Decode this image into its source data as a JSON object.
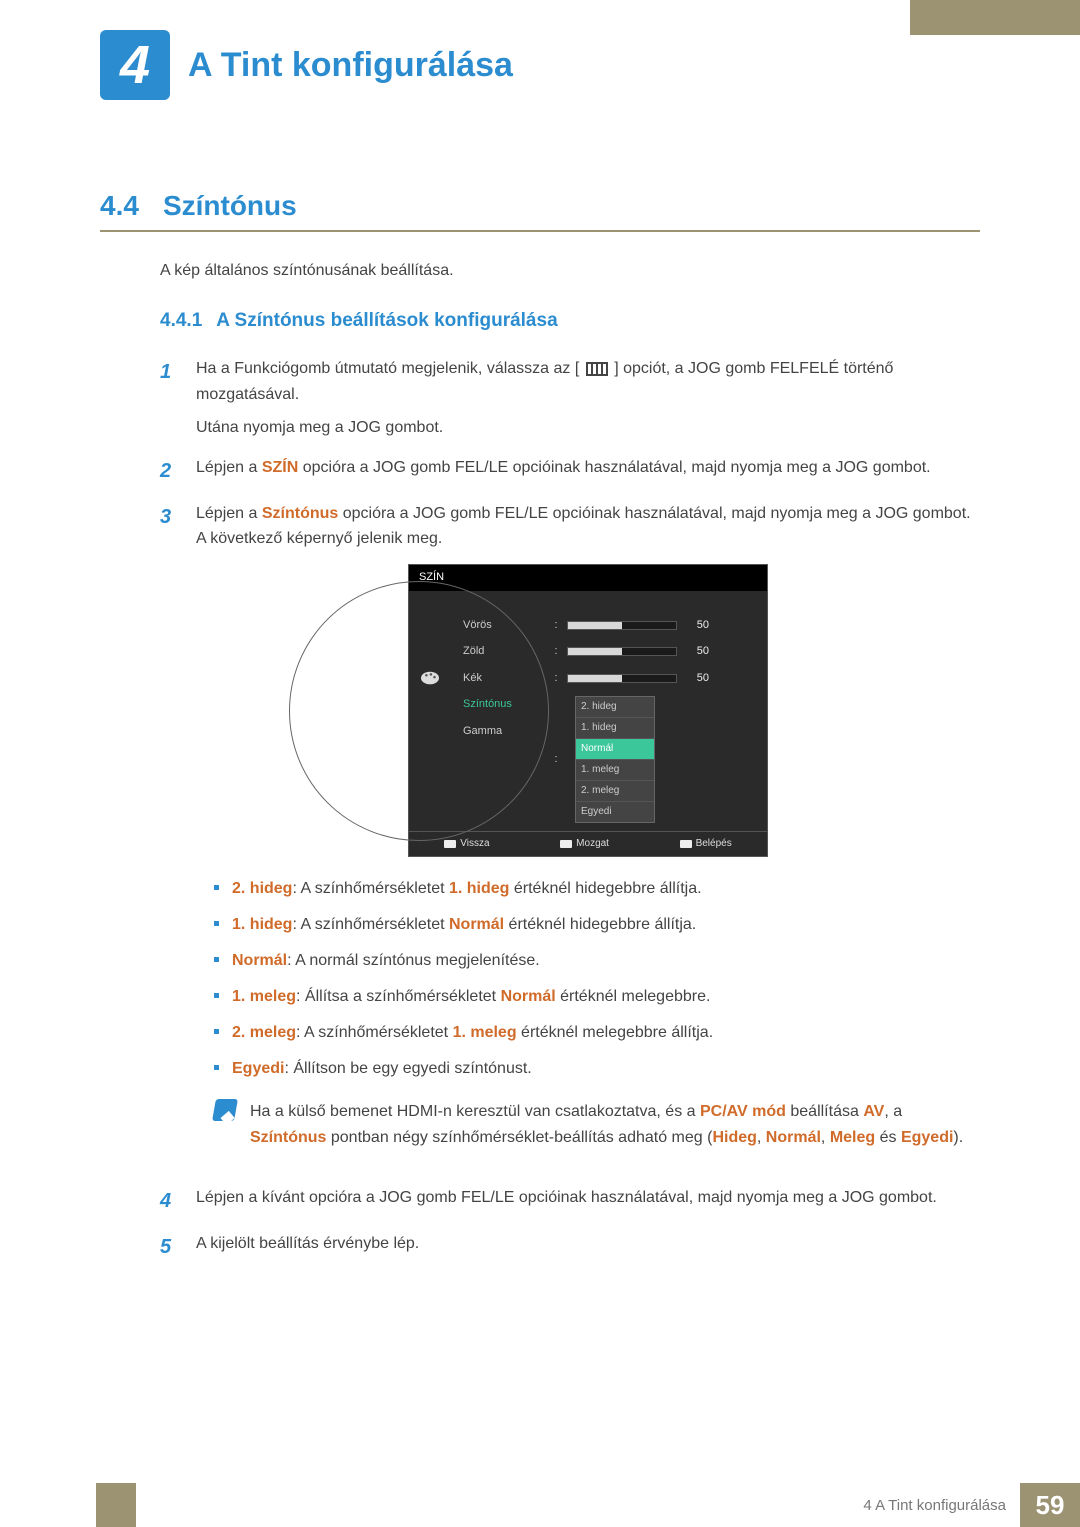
{
  "chapter": {
    "number": "4",
    "title": "A Tint konfigurálása"
  },
  "section": {
    "number": "4.4",
    "title": "Színtónus"
  },
  "lead": "A kép általános színtónusának beállítása.",
  "subsection": {
    "number": "4.4.1",
    "title": "A Színtónus beállítások konfigurálása"
  },
  "steps": {
    "s1": {
      "num": "1",
      "p1a": "Ha a Funkciógomb útmutató megjelenik, válassza az [",
      "p1b": "] opciót, a JOG gomb FELFELÉ történő mozgatásával.",
      "p2": "Utána nyomja meg a JOG gombot."
    },
    "s2": {
      "num": "2",
      "before": "Lépjen a ",
      "hl": "SZÍN",
      "after": " opcióra a JOG gomb FEL/LE opcióinak használatával, majd nyomja meg a JOG gombot."
    },
    "s3": {
      "num": "3",
      "before": "Lépjen a ",
      "hl": "Színtónus",
      "after": " opcióra a JOG gomb FEL/LE opcióinak használatával, majd nyomja meg a JOG gombot. A következő képernyő jelenik meg."
    },
    "s4": {
      "num": "4",
      "text": "Lépjen a kívánt opcióra a JOG gomb FEL/LE opcióinak használatával, majd nyomja meg a JOG gombot."
    },
    "s5": {
      "num": "5",
      "text": "A kijelölt beállítás érvénybe lép."
    }
  },
  "osd": {
    "header": "SZÍN",
    "rows": {
      "r1": {
        "label": "Vörös",
        "val": "50"
      },
      "r2": {
        "label": "Zöld",
        "val": "50"
      },
      "r3": {
        "label": "Kék",
        "val": "50"
      },
      "r4": {
        "label": "Színtónus"
      },
      "r5": {
        "label": "Gamma"
      }
    },
    "options": {
      "o1": "2. hideg",
      "o2": "1. hideg",
      "o3": "Normál",
      "o4": "1. meleg",
      "o5": "2. meleg",
      "o6": "Egyedi"
    },
    "footer": {
      "back": "Vissza",
      "move": "Mozgat",
      "enter": "Belépés"
    }
  },
  "bullets": {
    "b1": {
      "k": "2. hideg",
      "pre": ": A színhőmérsékletet ",
      "hl": "1. hideg",
      "post": " értéknél hidegebbre állítja."
    },
    "b2": {
      "k": "1. hideg",
      "pre": ": A színhőmérsékletet ",
      "hl": "Normál",
      "post": " értéknél hidegebbre állítja."
    },
    "b3": {
      "k": "Normál",
      "text": ": A normál színtónus megjelenítése."
    },
    "b4": {
      "k": "1. meleg",
      "pre": ": Állítsa a színhőmérsékletet ",
      "hl": "Normál",
      "post": " értéknél melegebbre."
    },
    "b5": {
      "k": "2. meleg",
      "pre": ": A színhőmérsékletet ",
      "hl": "1. meleg",
      "post": " értéknél melegebbre állítja."
    },
    "b6": {
      "k": "Egyedi",
      "text": ": Állítson be egy egyedi színtónust."
    }
  },
  "note": {
    "t1": "Ha a külső bemenet HDMI-n keresztül van csatlakoztatva, és a ",
    "h1": "PC/AV mód",
    "t2": " beállítása ",
    "h2": "AV",
    "t3": ", a ",
    "h3": "Színtónus",
    "t4": " pontban négy színhőmérséklet-beállítás adható meg (",
    "h4": "Hideg",
    "c1": ", ",
    "h5": "Normál",
    "c2": ", ",
    "h6": "Meleg",
    "t5": " és ",
    "h7": "Egyedi",
    "t6": ")."
  },
  "footer": {
    "title": "4 A Tint konfigurálása",
    "page": "59"
  }
}
